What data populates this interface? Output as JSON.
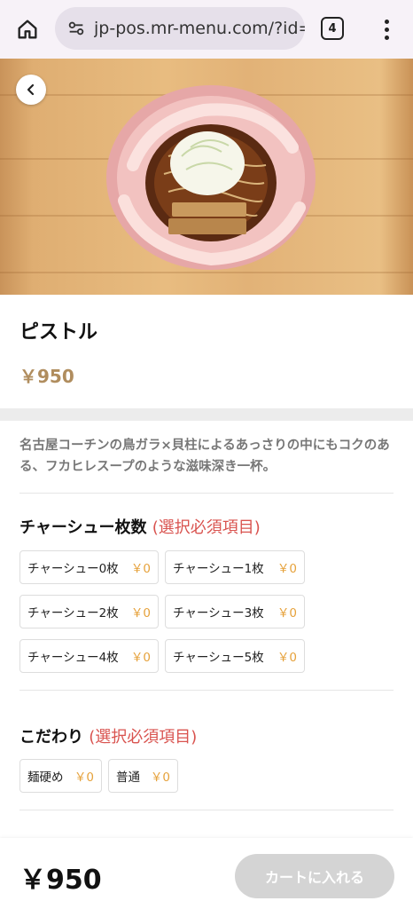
{
  "browser": {
    "url": "jp-pos.mr-menu.com/?id=",
    "tab_count": "4",
    "icons": {
      "home": "home-icon",
      "site": "site-settings-icon",
      "tabs": "tab-switcher-icon",
      "menu": "more-vert-icon"
    }
  },
  "product": {
    "name": "ピストル",
    "price": "￥950",
    "description": "名古屋コーチンの鳥ガラ×貝柱によるあっさりの中にもコクのある、フカヒレスープのような滋味深き一杯。"
  },
  "sections": [
    {
      "title": "チャーシュー枚数",
      "required": "(選択必須項目)",
      "options": [
        {
          "label": "チャーシュー0枚",
          "price": "￥0"
        },
        {
          "label": "チャーシュー1枚",
          "price": "￥0"
        },
        {
          "label": "チャーシュー2枚",
          "price": "￥0"
        },
        {
          "label": "チャーシュー3枚",
          "price": "￥0"
        },
        {
          "label": "チャーシュー4枚",
          "price": "￥0"
        },
        {
          "label": "チャーシュー5枚",
          "price": "￥0"
        }
      ]
    },
    {
      "title": "こだわり",
      "required": "(選択必須項目)",
      "options": [
        {
          "label": "麺硬め",
          "price": "￥0"
        },
        {
          "label": "普通",
          "price": "￥0"
        }
      ]
    }
  ],
  "footer": {
    "total": "￥950",
    "cart_button": "カートに入れる"
  },
  "colors": {
    "price_accent": "#b08d5e",
    "option_price": "#e6a23c",
    "required": "#d9534f",
    "disabled_button": "#d4d4d4"
  }
}
